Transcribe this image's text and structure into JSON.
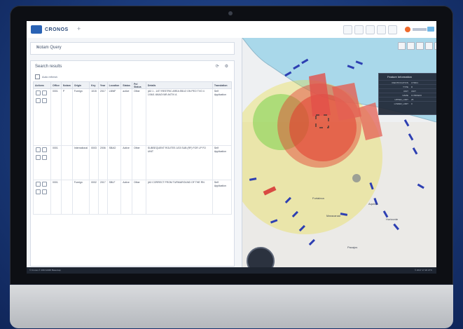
{
  "app": {
    "brand": "CRONOS"
  },
  "query": {
    "label": "Notam Query"
  },
  "results": {
    "title": "Search results",
    "checkbox_label": "Auto refresh",
    "columns": [
      "Actions",
      "Office",
      "Notam",
      "Origin",
      "Key",
      "Year",
      "Location",
      "Status",
      "Pol Status",
      "Details",
      "Translation"
    ],
    "rows": [
      {
        "cells": [
          "",
          "0001",
          "P",
          "Foreign",
          "1015",
          "2017",
          "LBWF",
          "active",
          "Other",
          "(A0 1 - 1/07 RESTRIC AREA EB1/2 ON PEO TVO 4 1/06/1 4MAGYAR AKTIV A",
          "Self Application"
        ]
      },
      {
        "cells": [
          "",
          "0001",
          "",
          "International",
          "0003",
          "2006",
          "SBAO",
          "Active",
          "Other",
          "SUBSEQUENT ROUTES 1/03 SUB (RF) FOR LP FO UNIT",
          "Self Application"
        ]
      },
      {
        "cells": [
          "",
          "0001",
          "",
          "Foreign",
          "0002",
          "2017",
          "SBLF",
          "Active",
          "Other",
          "(A0 CORRECT FROM TURMAROUND OF THE RN",
          "Self Application"
        ]
      }
    ]
  },
  "feature_panel": {
    "title": "Feature Information",
    "rows": [
      {
        "k": "IDENTIFICATION",
        "v": "CTRD1"
      },
      {
        "k": "TYPE",
        "v": "D"
      },
      {
        "k": "UNIT",
        "v": "UNIT"
      },
      {
        "k": "NAME",
        "v": "FLTRDEF0"
      },
      {
        "k": "UPPER_LIMIT",
        "v": "25"
      },
      {
        "k": "LOWER_LIMIT",
        "v": "0"
      }
    ]
  },
  "map": {
    "labels": [
      "Fortaleza",
      "Maracanaú",
      "Aquiraz",
      "Horizonte",
      "Pacajus"
    ]
  },
  "statusbar": {
    "left": "© Cronos © 2016 ESRI Basemap",
    "right": "© 2017 17:18 UTC"
  },
  "colors": {
    "accent": "#2a63b5",
    "red_zone": "#e23b2e",
    "yellow_zone": "#e8de3a",
    "green_zone": "#7ad14a",
    "track_blue": "#2d3fb2"
  }
}
